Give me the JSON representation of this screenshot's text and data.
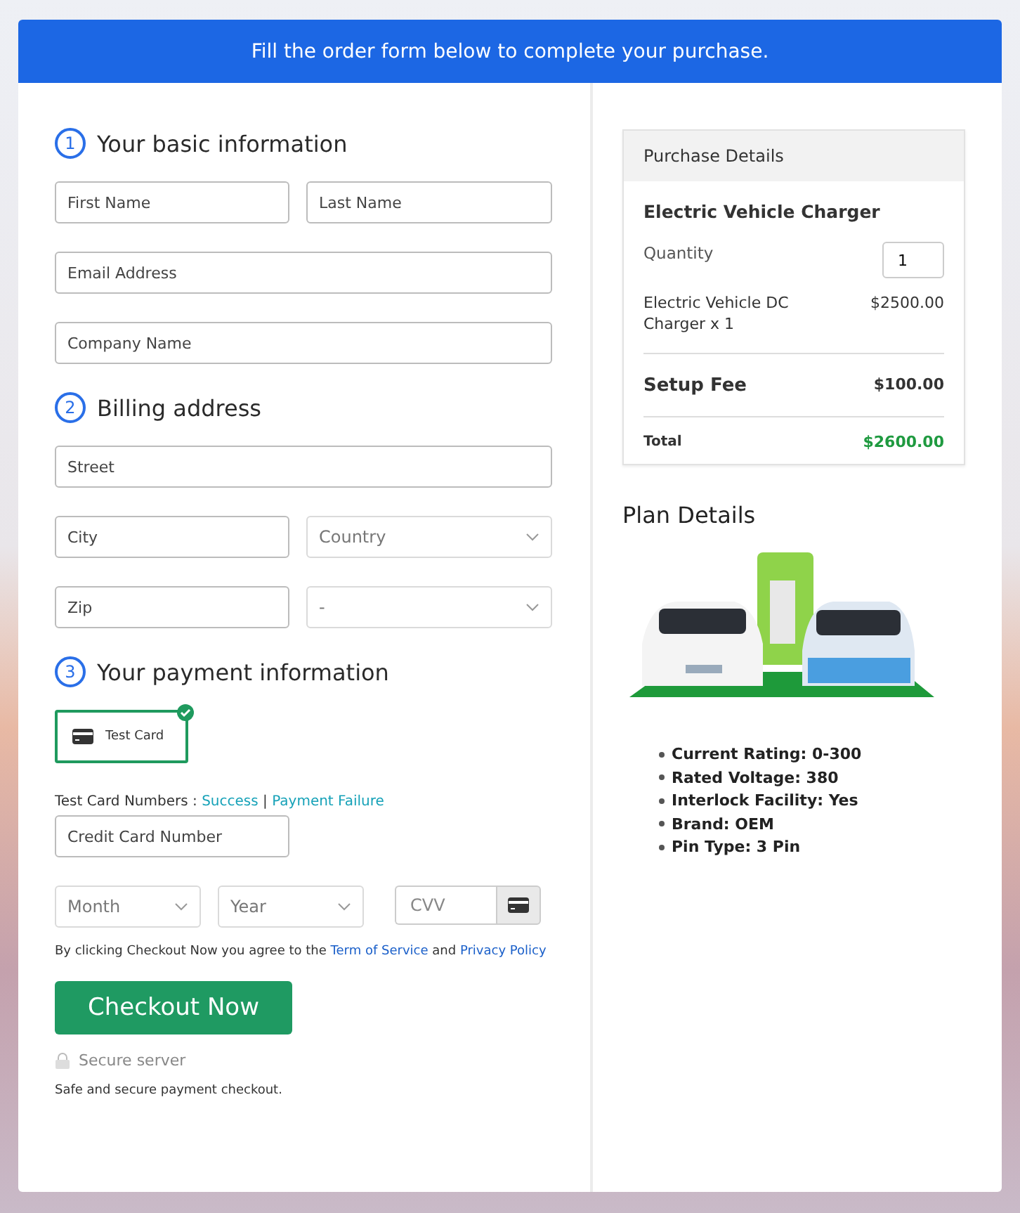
{
  "banner": "Fill the order form below to complete your purchase.",
  "sections": [
    {
      "number": "1",
      "title": "Your basic information"
    },
    {
      "number": "2",
      "title": "Billing address"
    },
    {
      "number": "3",
      "title": "Your payment information"
    }
  ],
  "basic_fields": [
    {
      "placeholder": "First Name"
    },
    {
      "placeholder": "Last Name"
    },
    {
      "placeholder": "Email Address"
    },
    {
      "placeholder": "Company Name"
    }
  ],
  "billing_fields": [
    {
      "kind": "input",
      "placeholder": "Street"
    },
    {
      "kind": "input",
      "placeholder": "City"
    },
    {
      "kind": "select",
      "value": "Country"
    },
    {
      "kind": "input",
      "placeholder": "Zip"
    },
    {
      "kind": "select",
      "value": "-"
    }
  ],
  "payment_options": [
    {
      "label": "Test Card",
      "selected": true
    }
  ],
  "test_cards": {
    "label": "Test Card Numbers :",
    "links": [
      "Success",
      "Payment Failure"
    ],
    "separator": "|"
  },
  "card_number": {
    "placeholder": "Credit Card Number"
  },
  "expiry": [
    {
      "value": "Month"
    },
    {
      "value": "Year"
    }
  ],
  "cvv": {
    "placeholder": "CVV"
  },
  "terms": {
    "text": "By clicking Checkout Now you agree to the",
    "link_1": "Term of Service",
    "joiner": "and",
    "link_2": "Privacy Policy"
  },
  "checkout_button": "Checkout Now",
  "secure_label": "Secure server",
  "secure_note": "Safe and secure payment checkout.",
  "purchase": {
    "title": "Purchase Details",
    "product": "Electric Vehicle Charger",
    "quantity_label": "Quantity",
    "quantity": "1",
    "item": "Electric Vehicle DC Charger x 1",
    "item_price": "$2500.00",
    "fee_label": "Setup Fee",
    "fee": "$100.00",
    "total_label": "Total",
    "total": "$2600.00"
  },
  "plan": {
    "title": "Plan Details",
    "features": [
      "Current Rating: 0-300",
      "Rated Voltage: 380",
      "Interlock Facility: Yes",
      "Brand: OEM",
      "Pin Type: 3 Pin"
    ]
  }
}
